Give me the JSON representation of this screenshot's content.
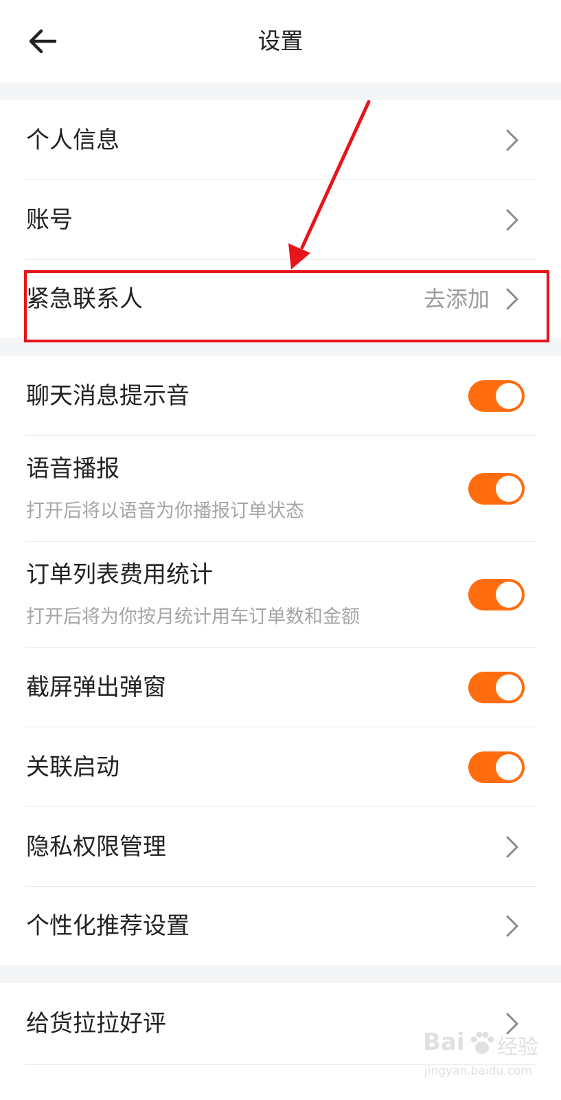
{
  "header": {
    "title": "设置",
    "back_icon": "arrow-left-icon"
  },
  "account_section": {
    "items": [
      {
        "label": "个人信息",
        "icon": "chevron-right-icon"
      },
      {
        "label": "账号",
        "icon": "chevron-right-icon"
      },
      {
        "label": "紧急联系人",
        "value": "去添加",
        "icon": "chevron-right-icon"
      }
    ]
  },
  "toggle_section": {
    "items": [
      {
        "label": "聊天消息提示音",
        "enabled": true
      },
      {
        "label": "语音播报",
        "description": "打开后将以语音为你播报订单状态",
        "enabled": true
      },
      {
        "label": "订单列表费用统计",
        "description": "打开后将为你按月统计用车订单数和金额",
        "enabled": true
      },
      {
        "label": "截屏弹出弹窗",
        "enabled": true
      },
      {
        "label": "关联启动",
        "enabled": true
      }
    ],
    "toggle_on_color": "#ff6d0f"
  },
  "privacy_section": {
    "items": [
      {
        "label": "隐私权限管理",
        "icon": "chevron-right-icon"
      },
      {
        "label": "个性化推荐设置",
        "icon": "chevron-right-icon"
      }
    ]
  },
  "feedback_section": {
    "items": [
      {
        "label": "给货拉拉好评",
        "icon": "chevron-right-icon"
      }
    ]
  },
  "annotation": {
    "color": "#e8141b",
    "target": "紧急联系人"
  },
  "watermark": {
    "brand": "Bai",
    "brand_suffix": "经验",
    "url": "jingyan.baidu.com"
  }
}
